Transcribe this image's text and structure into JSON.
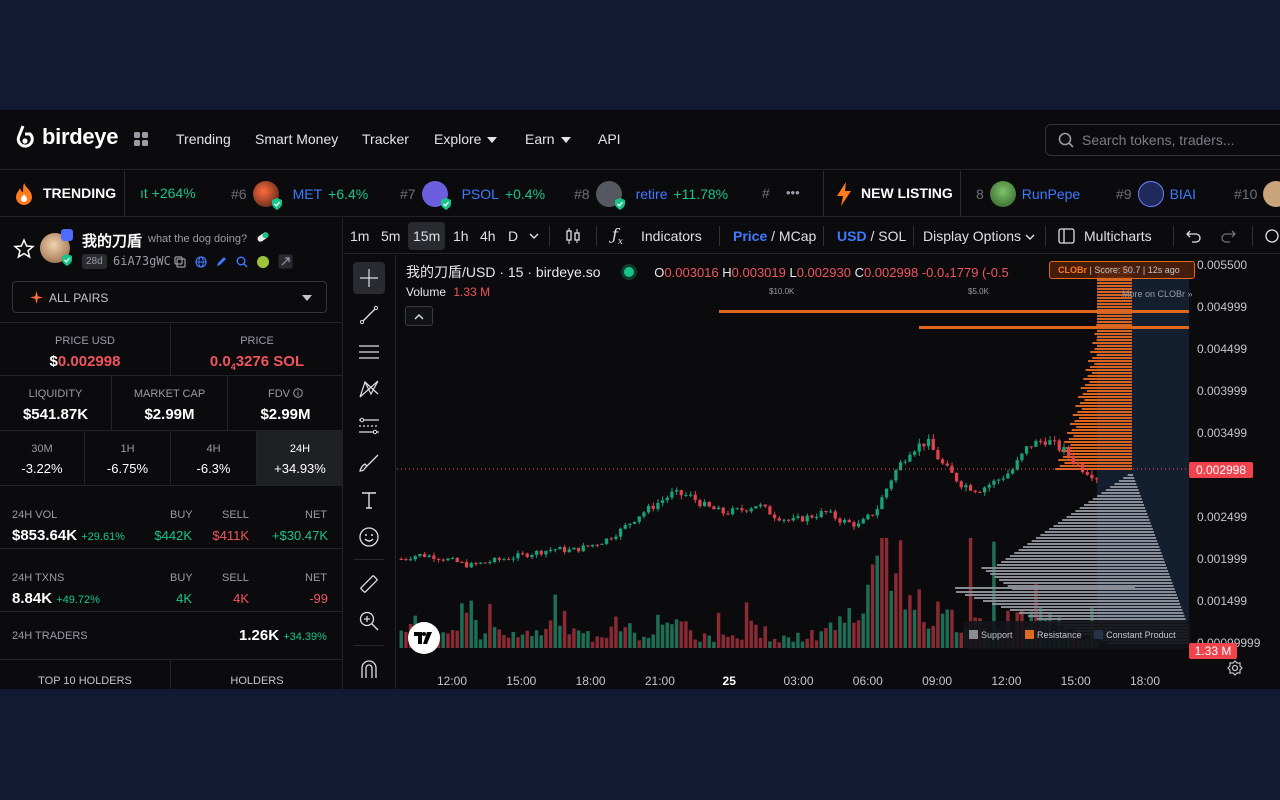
{
  "brand": {
    "name": "birdeye"
  },
  "nav": {
    "items": [
      "Trending",
      "Smart Money",
      "Tracker",
      "Explore",
      "Earn",
      "API"
    ]
  },
  "search": {
    "placeholder": "Search tokens, traders..."
  },
  "ticker": {
    "trending_label": "TRENDING",
    "new_listing_label": "NEW LISTING",
    "trending": [
      {
        "rank": "",
        "symbol": "",
        "change": "ıt +264%"
      },
      {
        "rank": "#6",
        "symbol": "MET",
        "change": "+6.4%"
      },
      {
        "rank": "#7",
        "symbol": "PSOL",
        "change": "+0.4%"
      },
      {
        "rank": "#8",
        "symbol": "retire",
        "change": "+11.78%"
      },
      {
        "rank": "#",
        "symbol": "",
        "change": ""
      }
    ],
    "new": [
      {
        "rank": "8",
        "symbol": "RunPepe"
      },
      {
        "rank": "#9",
        "symbol": "BIAI"
      },
      {
        "rank": "#10",
        "symbol": ""
      }
    ],
    "more": "•••"
  },
  "token": {
    "name": "我的刀盾",
    "tagline": "what the dog doing?",
    "age": "28d",
    "address": "6iA73gWC",
    "pairs_label": "ALL PAIRS",
    "price_usd_label": "PRICE USD",
    "price_usd_prefix": "$",
    "price_usd": "0.002998",
    "price_label": "PRICE",
    "price_sol_prefix": "0.0",
    "price_sol_sub": "4",
    "price_sol": "3276 SOL",
    "liquidity_label": "LIQUIDITY",
    "liquidity": "$541.87K",
    "mcap_label": "MARKET CAP",
    "mcap": "$2.99M",
    "fdv_label": "FDV",
    "fdv": "$2.99M",
    "periods": [
      {
        "label": "30M",
        "value": "-3.22%"
      },
      {
        "label": "1H",
        "value": "-6.75%"
      },
      {
        "label": "4H",
        "value": "-6.3%"
      },
      {
        "label": "24H",
        "value": "+34.93%"
      }
    ],
    "vol": {
      "label": "24H VOL",
      "value": "$853.64K",
      "change": "+29.61%",
      "buy_label": "BUY",
      "buy": "$442K",
      "sell_label": "SELL",
      "sell": "$411K",
      "net_label": "NET",
      "net": "+$30.47K"
    },
    "txns": {
      "label": "24H TXNS",
      "value": "8.84K",
      "change": "+49.72%",
      "buy_label": "BUY",
      "buy": "4K",
      "sell_label": "SELL",
      "sell": "4K",
      "net_label": "NET",
      "net": "-99"
    },
    "traders": {
      "label": "24H TRADERS",
      "value": "1.26K",
      "change": "+34.39%"
    },
    "holders_tabs": [
      "TOP 10 HOLDERS",
      "HOLDERS"
    ]
  },
  "toolbar": {
    "intervals": [
      "1m",
      "5m",
      "15m",
      "1h",
      "4h",
      "D"
    ],
    "active_interval": "15m",
    "indicators": "Indicators",
    "price": "Price",
    "mcap": "MCap",
    "usd": "USD",
    "sol": "SOL",
    "display_options": "Display Options",
    "multicharts": "Multicharts"
  },
  "chart_data": {
    "type": "candlestick",
    "title": "我的刀盾/USD · 15 · birdeye.so",
    "ohlc": {
      "O": "0.003016",
      "H": "0.003019",
      "L": "0.002930",
      "C": "0.002998",
      "change": "-0.0₄1779 (-0.5"
    },
    "volume_label": "Volume",
    "volume_value": "1.33 M",
    "y_ticks": [
      "0.005500",
      "0.004999",
      "0.004499",
      "0.003999",
      "0.003499",
      "0.002998",
      "0.002499",
      "0.001999",
      "0.001499",
      "0.00099999"
    ],
    "current_price": "0.002998",
    "current_volume": "1.33 M",
    "x_ticks": [
      "12:00",
      "15:00",
      "18:00",
      "21:00",
      "25",
      "03:00",
      "06:00",
      "09:00",
      "12:00",
      "15:00",
      "18:00"
    ],
    "ylim": [
      0.00099999,
      0.0055
    ],
    "clobr": {
      "label": "CLOBr",
      "score": "Score: 50.7",
      "age": "12s ago",
      "more": "More on CLOBr »",
      "depth_ticks": [
        "$10.0K",
        "$5.0K"
      ]
    },
    "legend": [
      "Support",
      "Resistance",
      "Constant Product"
    ],
    "close_path": [
      0.002,
      0.00205,
      0.00203,
      0.00198,
      0.00192,
      0.00196,
      0.002,
      0.00204,
      0.00208,
      0.00212,
      0.0021,
      0.00215,
      0.00222,
      0.00235,
      0.00252,
      0.00265,
      0.00278,
      0.00275,
      0.00262,
      0.00255,
      0.00258,
      0.00265,
      0.00252,
      0.00245,
      0.0025,
      0.00256,
      0.00245,
      0.0024,
      0.00258,
      0.003,
      0.0033,
      0.0034,
      0.0031,
      0.0029,
      0.00282,
      0.00292,
      0.00305,
      0.00335,
      0.00342,
      0.0033,
      0.0031,
      0.00298
    ],
    "volume_path": [
      12,
      6,
      5,
      9,
      20,
      6,
      7,
      5,
      8,
      22,
      9,
      6,
      10,
      18,
      8,
      14,
      11,
      9,
      6,
      7,
      8,
      12,
      6,
      5,
      7,
      9,
      14,
      18,
      40,
      45,
      30,
      20,
      16,
      14,
      18,
      22,
      12,
      20,
      16,
      10,
      8,
      6
    ]
  }
}
